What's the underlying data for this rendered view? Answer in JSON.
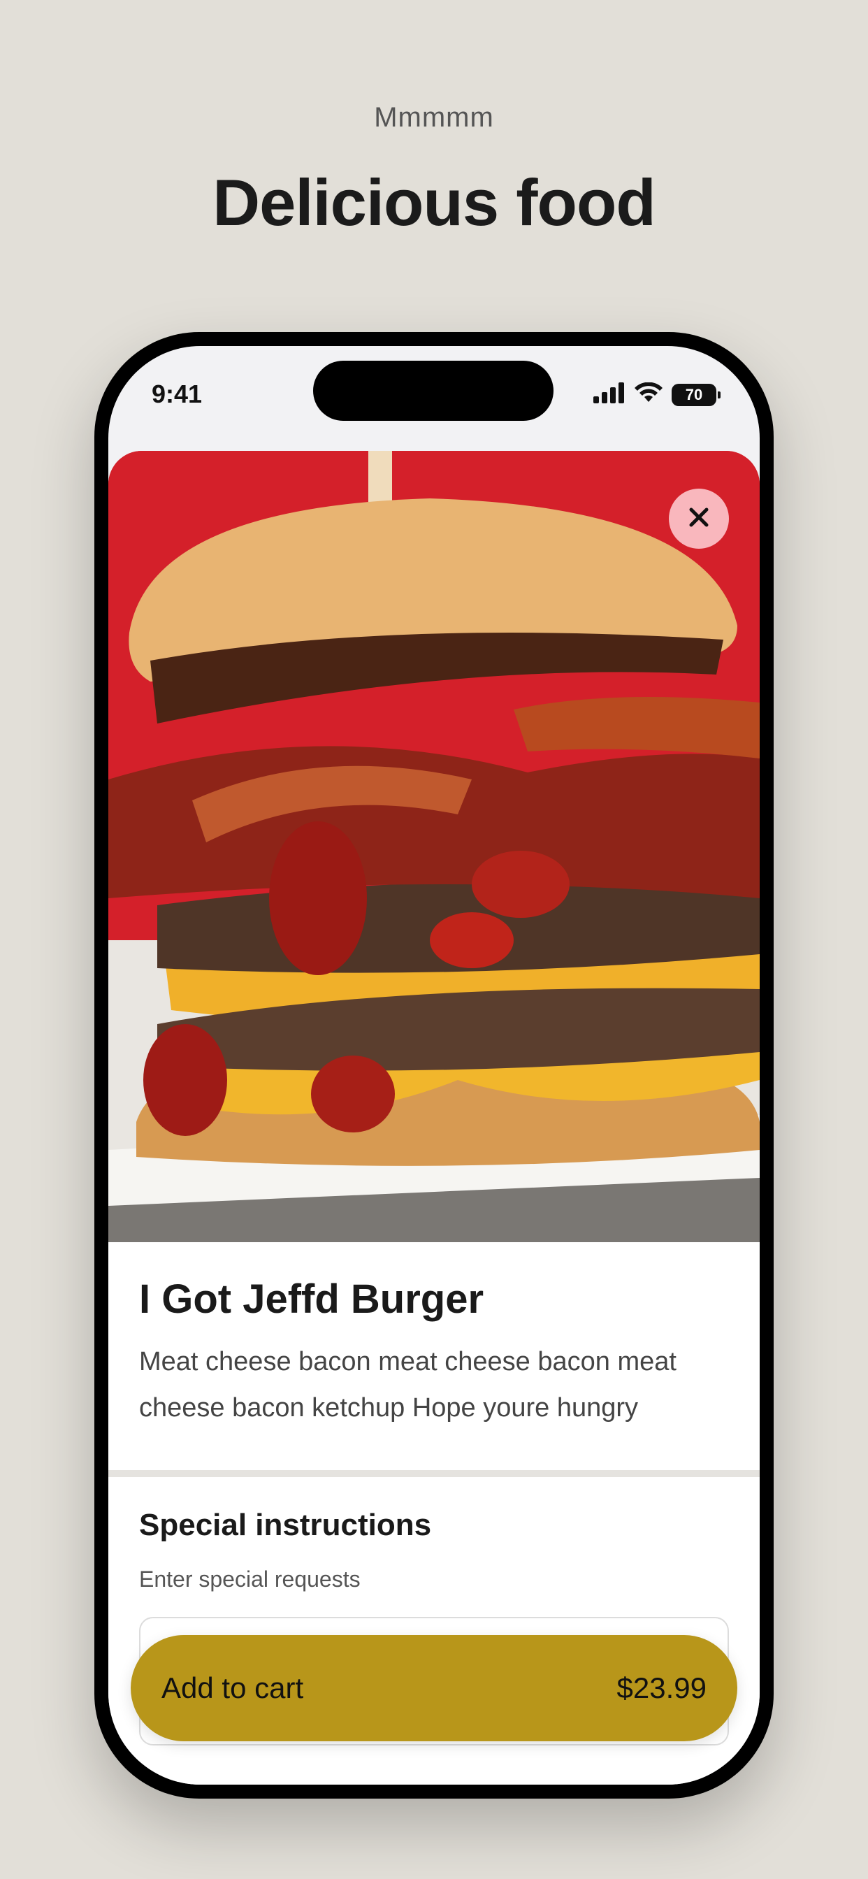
{
  "header": {
    "eyebrow": "Mmmmm",
    "title": "Delicious food"
  },
  "status_bar": {
    "time": "9:41",
    "battery": "70",
    "icons": [
      "signal-icon",
      "wifi-icon",
      "battery-icon"
    ]
  },
  "item": {
    "image": "burger-photo",
    "title": "I Got Jeffd Burger",
    "description": "Meat cheese bacon meat cheese bacon meat cheese bacon ketchup Hope youre hungry"
  },
  "instructions": {
    "title": "Special instructions",
    "subtitle": "Enter special requests"
  },
  "cart": {
    "label": "Add to cart",
    "price": "$23.99"
  },
  "colors": {
    "background": "#e2dfd8",
    "accent": "#b8961a",
    "hero_red": "#d4202a"
  }
}
